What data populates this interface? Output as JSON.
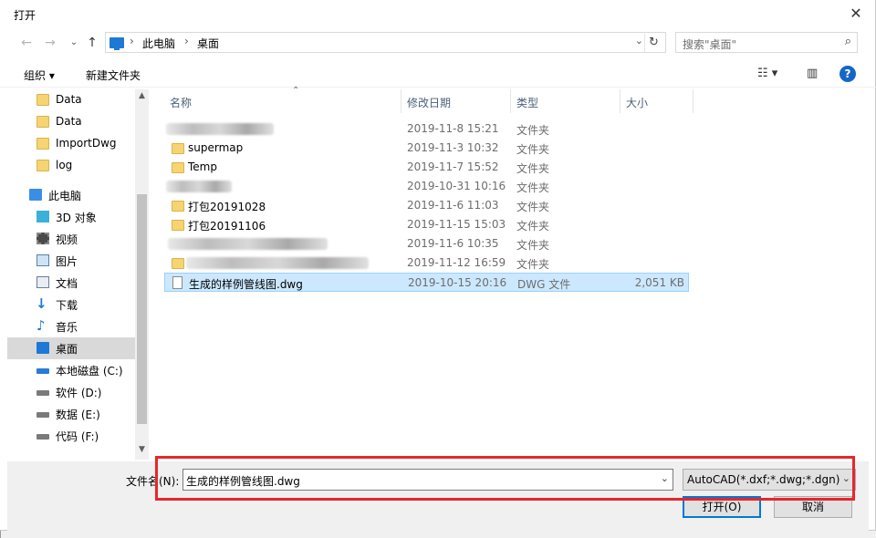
{
  "window": {
    "title": "打开",
    "close_icon": "close-icon"
  },
  "address": {
    "crumbs": [
      "此电脑",
      "桌面"
    ],
    "search_placeholder": "搜索\"桌面\""
  },
  "toolbar": {
    "organize": "组织 ▾",
    "new_folder": "新建文件夹",
    "help": "?"
  },
  "nav": {
    "items": [
      {
        "label": "Data",
        "icon": "folder-sync-icon"
      },
      {
        "label": "Data",
        "icon": "folder-icon"
      },
      {
        "label": "ImportDwg",
        "icon": "folder-icon"
      },
      {
        "label": "log",
        "icon": "folder-icon"
      },
      {
        "label": "此电脑",
        "icon": "computer-icon"
      },
      {
        "label": "3D 对象",
        "icon": "3d-objects-icon"
      },
      {
        "label": "视频",
        "icon": "videos-icon"
      },
      {
        "label": "图片",
        "icon": "pictures-icon"
      },
      {
        "label": "文档",
        "icon": "documents-icon"
      },
      {
        "label": "下载",
        "icon": "downloads-icon"
      },
      {
        "label": "音乐",
        "icon": "music-icon"
      },
      {
        "label": "桌面",
        "icon": "desktop-icon"
      },
      {
        "label": "本地磁盘 (C:)",
        "icon": "drive-c-icon"
      },
      {
        "label": "软件 (D:)",
        "icon": "drive-icon"
      },
      {
        "label": "数据 (E:)",
        "icon": "drive-icon"
      },
      {
        "label": "代码 (F:)",
        "icon": "drive-icon"
      }
    ]
  },
  "columns": {
    "name": "名称",
    "modified": "修改日期",
    "type": "类型",
    "size": "大小"
  },
  "files": [
    {
      "name": "",
      "date": "2019-11-8 15:21",
      "type": "文件夹",
      "size": "",
      "blurred": true
    },
    {
      "name": "supermap",
      "date": "2019-11-3 10:32",
      "type": "文件夹",
      "size": ""
    },
    {
      "name": "Temp",
      "date": "2019-11-7 15:52",
      "type": "文件夹",
      "size": ""
    },
    {
      "name": "",
      "date": "2019-10-31 10:16",
      "type": "文件夹",
      "size": "",
      "blurred": true
    },
    {
      "name": "打包20191028",
      "date": "2019-11-6 11:03",
      "type": "文件夹",
      "size": ""
    },
    {
      "name": "打包20191106",
      "date": "2019-11-15 15:03",
      "type": "文件夹",
      "size": ""
    },
    {
      "name": "",
      "date": "2019-11-6 10:35",
      "type": "文件夹",
      "size": "",
      "blurred": true
    },
    {
      "name": "",
      "date": "2019-11-12 16:59",
      "type": "文件夹",
      "size": "",
      "blurred": true
    },
    {
      "name": "生成的样例管线图.dwg",
      "date": "2019-10-15 20:16",
      "type": "DWG 文件",
      "size": "2,051 KB",
      "selected": true
    }
  ],
  "bottom": {
    "filename_label": "文件名(N):",
    "filename_value": "生成的样例管线图.dwg",
    "filetype_value": "AutoCAD(*.dxf;*.dwg;*.dgn)",
    "open_label": "打开(O)",
    "cancel_label": "取消"
  },
  "colors": {
    "selection": "#cce8ff",
    "accent": "#0078d7",
    "highlight_box": "#e8262a"
  }
}
